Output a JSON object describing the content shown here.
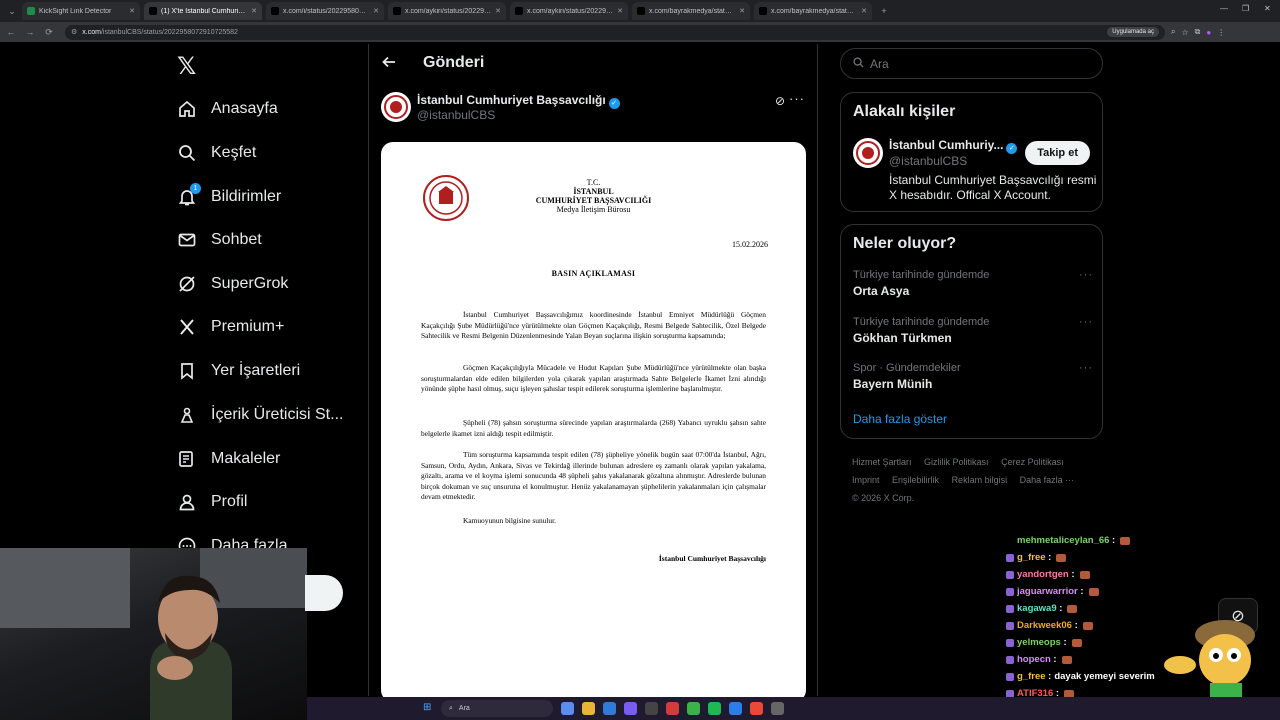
{
  "browser": {
    "tabs": [
      {
        "title": "KickSight Link Detector",
        "active": false,
        "color": "#1f8b4c"
      },
      {
        "title": "(1) X'te İstanbul Cumhuriyet Ba",
        "active": true,
        "color": "#000000"
      },
      {
        "title": "x.com/i/status/2022958079291",
        "active": false,
        "color": "#000000"
      },
      {
        "title": "x.com/aykiri/status/2022957377",
        "active": false,
        "color": "#000000"
      },
      {
        "title": "x.com/aykiri/status/2022957377",
        "active": false,
        "color": "#000000"
      },
      {
        "title": "x.com/bayrakmedya/status/20",
        "active": false,
        "color": "#000000"
      },
      {
        "title": "x.com/bayrakmedya/status/20",
        "active": false,
        "color": "#000000"
      }
    ],
    "url_host": "x.com",
    "url_path": "/istanbulCBS/status/2022958072910725582",
    "translate_pill": "Uygulamada aç"
  },
  "nav": {
    "items": [
      {
        "label": "Anasayfa",
        "icon": "home-icon"
      },
      {
        "label": "Keşfet",
        "icon": "search-icon"
      },
      {
        "label": "Bildirimler",
        "icon": "bell-icon",
        "badge": "1"
      },
      {
        "label": "Sohbet",
        "icon": "mail-icon"
      },
      {
        "label": "SuperGrok",
        "icon": "grok-icon"
      },
      {
        "label": "Premium+",
        "icon": "x-icon"
      },
      {
        "label": "Yer İşaretleri",
        "icon": "bookmark-icon"
      },
      {
        "label": "İçerik Üreticisi St...",
        "icon": "creator-icon"
      },
      {
        "label": "Makaleler",
        "icon": "article-icon"
      },
      {
        "label": "Profil",
        "icon": "profile-icon"
      },
      {
        "label": "Daha fazla",
        "icon": "more-circle-icon"
      }
    ]
  },
  "post": {
    "header_title": "Gönderi",
    "author_name": "İstanbul Cumhuriyet Başsavcılığı",
    "author_handle": "@istanbulCBS",
    "document": {
      "head": [
        "T.C.",
        "İSTANBUL",
        "CUMHURİYET BAŞSAVCILIĞI",
        "Medya İletişim Bürosu"
      ],
      "date": "15.02.2026",
      "title": "BASIN AÇIKLAMASI",
      "paragraphs": [
        "İstanbul Cumhuriyet Başsavcılığımız koordinesinde İstanbul Emniyet Müdürlüğü Göçmen Kaçakçılığı Şube Müdürlüğü'nce yürütülmekte olan Göçmen Kaçakçılığı, Resmi Belgede Sahtecilik, Özel Belgede Sahtecilik ve Resmi Belgenin Düzenlenmesinde Yalan Beyan suçlarına ilişkin soruşturma kapsamında;",
        "Göçmen Kaçakçılığıyla Mücadele ve Hudut Kapıları Şube Müdürlüğü'nce yürütülmekte olan başka soruşturmalardan elde edilen bilgilerden yola çıkarak yapılan araştırmada Sahte Belgelerle İkamet İzni alındığı yönünde şüphe hasıl olmuş, suçu işleyen şahıslar tespit edilerek soruşturma işlemlerine başlanılmıştır.",
        "Şüpheli (78) şahsın soruşturma sürecinde yapılan araştırmalarda (268) Yabancı uyruklu şahsın sahte belgelerle ikamet izni aldığı tespit edilmiştir.",
        "Tüm soruşturma kapsamında tespit edilen (78) şüpheliye yönelik bugün saat 07:00'da İstanbul, Ağrı, Samsun, Ordu, Aydın, Ankara, Sivas ve Tekirdağ illerinde bulunan adreslere eş zamanlı olarak yapılan yakalama, gözaltı, arama ve el koyma işlemi sonucunda 48 şüpheli şahıs yakalanarak gözaltına alınmıştır. Adreslerde bulunan birçok dokuman ve suç unsuruna el konulmuştur. Henüz yakalanamayan şüphelilerin yakalanmaları için çalışmalar devam etmektedir.",
        "Kamuoyunun bilgisine sunulur."
      ],
      "signature": "İstanbul Cumhuriyet Başsavcılığı"
    }
  },
  "right": {
    "search_placeholder": "Ara",
    "related_title": "Alakalı kişiler",
    "related_name": "İstanbul Cumhuriy...",
    "related_handle": "@istanbulCBS",
    "follow_label": "Takip et",
    "related_bio": "İstanbul Cumhuriyet Başsavcılığı resmi X hesabıdır. Offical X Account.",
    "trends_title": "Neler oluyor?",
    "trends": [
      {
        "context": "Türkiye tarihinde gündemde",
        "name": "Orta Asya"
      },
      {
        "context": "Türkiye tarihinde gündemde",
        "name": "Gökhan Türkmen"
      },
      {
        "context": "Spor · Gündemdekiler",
        "name": "Bayern Münih"
      }
    ],
    "show_more": "Daha fazla göster",
    "footer_links": [
      "Hizmet Şartları",
      "Gizlilik Politikası",
      "Çerez Politikası",
      "Imprint",
      "Erişilebilirlik",
      "Reklam bilgisi",
      "Daha fazla ···"
    ],
    "copyright": "© 2026 X Corp."
  },
  "chat": [
    {
      "user": "mehmetaliceylan_66",
      "color": "#7fd16a",
      "msg": ""
    },
    {
      "user": "g_free",
      "color": "#f0c23a",
      "msg": ""
    },
    {
      "user": "yandortgen",
      "color": "#ff7aa2",
      "msg": ""
    },
    {
      "user": "jaguarwarrior",
      "color": "#d88cff",
      "msg": ""
    },
    {
      "user": "kagawa9",
      "color": "#5de3c4",
      "msg": ""
    },
    {
      "user": "Darkweek06",
      "color": "#f5a623",
      "msg": ""
    },
    {
      "user": "yelmeops",
      "color": "#7fd16a",
      "msg": ""
    },
    {
      "user": "hopecn",
      "color": "#d88cff",
      "msg": ""
    },
    {
      "user": "g_free",
      "color": "#f0c23a",
      "msg": "dayak yemeyi severim"
    },
    {
      "user": "ATIF316",
      "color": "#ff5a5a",
      "msg": ""
    }
  ],
  "taskbar": {
    "search_placeholder": "Ara"
  },
  "colors": {
    "accent": "#1d9bf0",
    "background": "#000000",
    "border": "#2f3336"
  }
}
